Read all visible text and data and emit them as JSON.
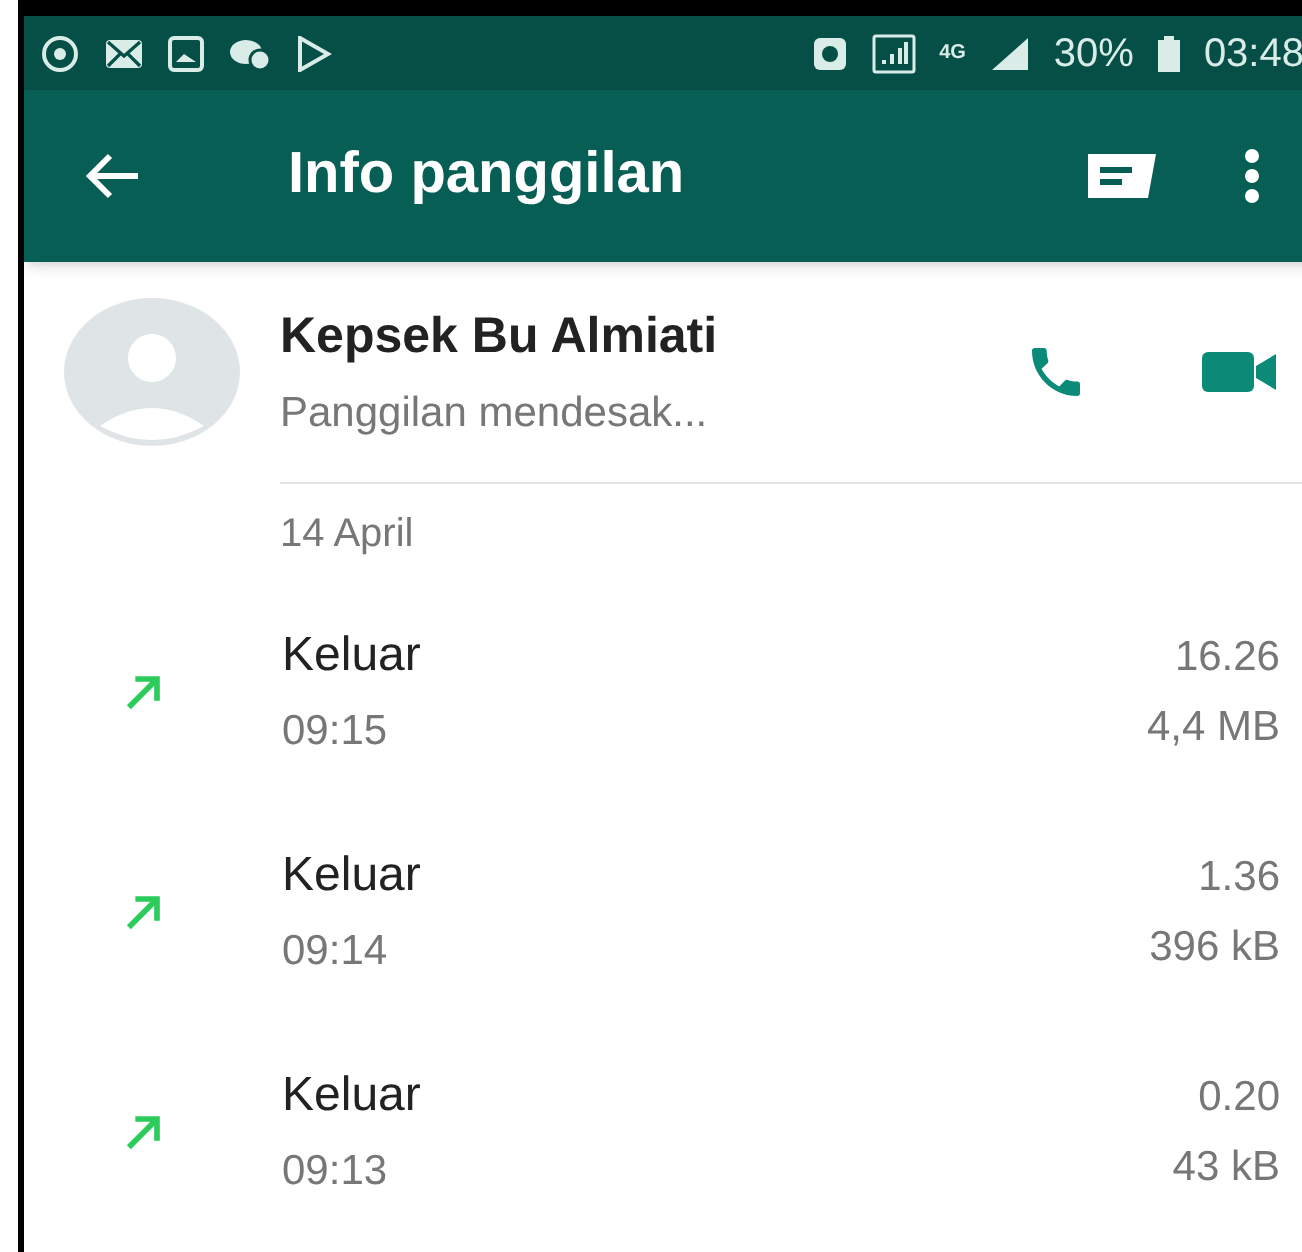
{
  "status_bar": {
    "network": "4G",
    "battery": "30%",
    "time": "03:48"
  },
  "app_bar": {
    "title": "Info panggilan"
  },
  "contact": {
    "name": "Kepsek Bu Almiati",
    "status": "Panggilan mendesak..."
  },
  "date": "14 April",
  "calls": [
    {
      "kind": "outgoing",
      "label": "Keluar",
      "time": "09:15",
      "duration": "16.26",
      "size": "4,4 MB"
    },
    {
      "kind": "outgoing",
      "label": "Keluar",
      "time": "09:14",
      "duration": "1.36",
      "size": "396 kB"
    },
    {
      "kind": "outgoing",
      "label": "Keluar",
      "time": "09:13",
      "duration": "0.20",
      "size": "43 kB"
    }
  ]
}
